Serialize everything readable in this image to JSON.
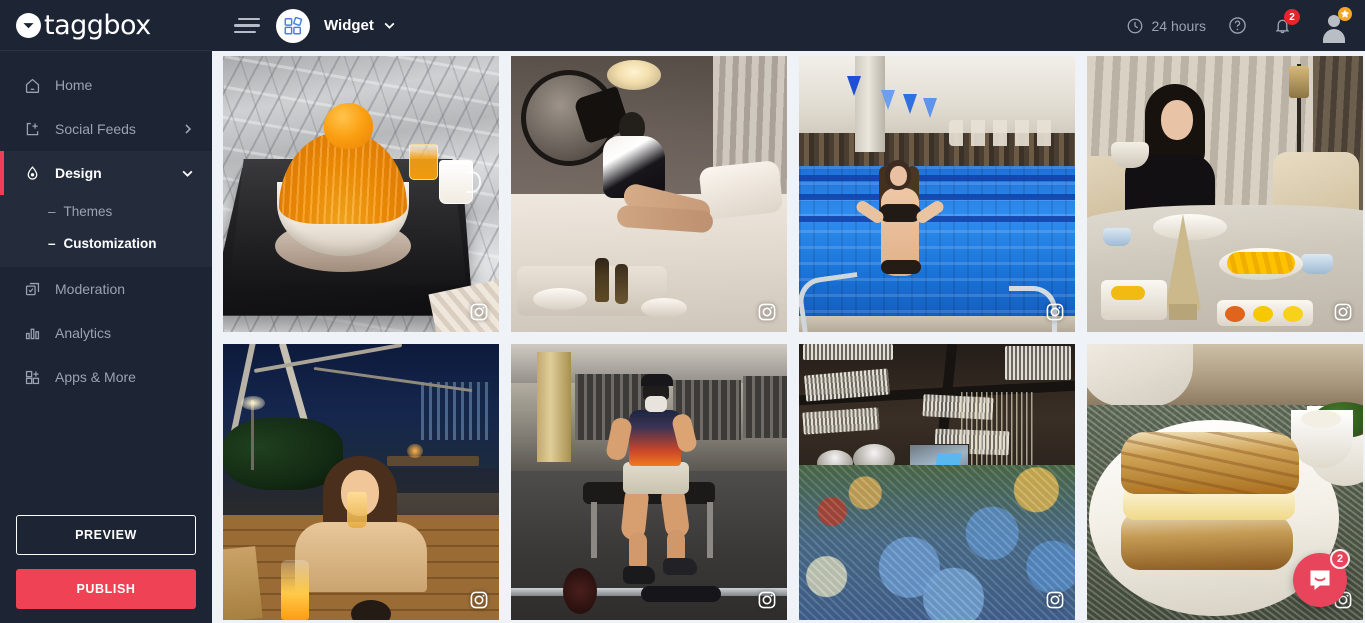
{
  "brand": {
    "name": "taggbox",
    "logo_icon": "taggbox-chat-logo-icon"
  },
  "sidebar": {
    "items": [
      {
        "label": "Home",
        "icon": "home-icon",
        "active": false,
        "expandable": false
      },
      {
        "label": "Social Feeds",
        "icon": "add-feed-icon",
        "active": false,
        "expandable": true,
        "chevron": "chevron-right-icon"
      },
      {
        "label": "Design",
        "icon": "design-drop-icon",
        "active": true,
        "expandable": true,
        "chevron": "chevron-down-icon"
      },
      {
        "label": "Moderation",
        "icon": "moderation-icon",
        "active": false,
        "expandable": false
      },
      {
        "label": "Analytics",
        "icon": "analytics-bar-icon",
        "active": false,
        "expandable": false
      },
      {
        "label": "Apps & More",
        "icon": "apps-grid-plus-icon",
        "active": false,
        "expandable": false
      }
    ],
    "design_subitems": [
      {
        "label": "Themes",
        "active": false
      },
      {
        "label": "Customization",
        "active": true
      }
    ],
    "preview_label": "PREVIEW",
    "publish_label": "PUBLISH"
  },
  "topbar": {
    "menu_icon": "hamburger-menu-icon",
    "widget_icon": "widget-grid-icon",
    "widget_name": "Widget",
    "widget_chevron": "chevron-down-icon",
    "clock_icon": "clock-icon",
    "hours_label": "24 hours",
    "help_icon": "help-circle-icon",
    "bell_icon": "notification-bell-icon",
    "bell_count": "2",
    "avatar_icon": "user-avatar-icon",
    "avatar_badge_icon": "star-badge-icon"
  },
  "colors": {
    "sidebar_bg": "#1d2433",
    "sidebar_active_bg": "#242c3c",
    "accent_red": "#ef4254",
    "active_marker": "#ef3e56",
    "content_bg": "#eff3f8",
    "badge_red": "#e5242c",
    "avatar_star": "#f5a623",
    "intercom_red": "#e8455c",
    "widget_icon_blue": "#4a7de0"
  },
  "feed": {
    "source_badge_icon": "instagram-icon",
    "tiles": [
      {
        "id": 1,
        "alt": "Mango shaved ice bingsu in a white bowl on a black tray on a marble table",
        "source": "instagram"
      },
      {
        "id": 2,
        "alt": "Woman sitting on a hotel bed with a round wall mirror and food tray",
        "source": "instagram"
      },
      {
        "id": 3,
        "alt": "Woman in a bikini standing in an indoor swimming pool holding the ladder rails",
        "source": "instagram"
      },
      {
        "id": 4,
        "alt": "Woman holding a coffee cup at a marble breakfast table with mango and pastries",
        "source": "instagram"
      },
      {
        "id": 5,
        "alt": "Woman at an outdoor night terrace table with candle light and city view",
        "source": "instagram"
      },
      {
        "id": 6,
        "alt": "Person in a cap and mask sitting on a gym bench with a barbell on the floor",
        "source": "instagram"
      },
      {
        "id": 7,
        "alt": "Banquet hall with crystal chandeliers, projector screen and blue floral arrangements",
        "source": "instagram"
      },
      {
        "id": 8,
        "alt": "Grilled cheese sandwich halves on a white plate on a granite table",
        "source": "instagram"
      }
    ]
  },
  "intercom": {
    "icon": "intercom-chat-icon",
    "count": "2"
  }
}
